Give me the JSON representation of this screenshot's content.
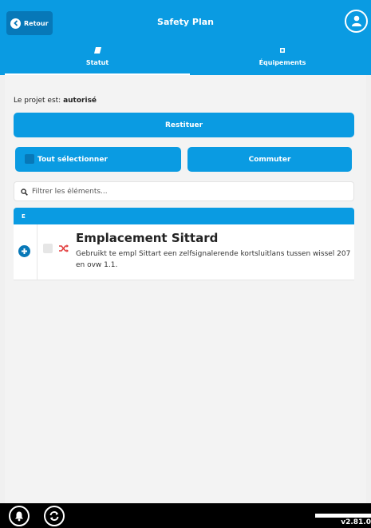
{
  "header": {
    "back_label": "Retour",
    "title": "Safety Plan",
    "avatar_icon": "user-icon",
    "tabs": [
      {
        "label": "Statut",
        "icon": "tag-icon",
        "active": true
      },
      {
        "label": "Équipements",
        "icon": "square-icon",
        "active": false
      }
    ]
  },
  "status": {
    "prefix": "Le projet est:",
    "value": "autorisé"
  },
  "actions": {
    "restore_label": "Restituer",
    "select_all_label": "Tout sélectionner",
    "switch_label": "Commuter"
  },
  "search": {
    "placeholder": "Filtrer les éléments...",
    "value": ""
  },
  "group": {
    "letter": "E",
    "items": [
      {
        "name": "Emplacement Sittard",
        "description": "Gebruikt te empl Sittart een zelfsignalerende kortsluitlans tussen wissel 207 en ovw 1.1.",
        "route_icon": "shuffle-icon"
      }
    ]
  },
  "footer": {
    "version": "v2.81.0"
  },
  "colors": {
    "primary": "#0a9be2",
    "primary_dark": "#0778b8",
    "route_icon": "#e23b3b",
    "footer": "#000000"
  }
}
